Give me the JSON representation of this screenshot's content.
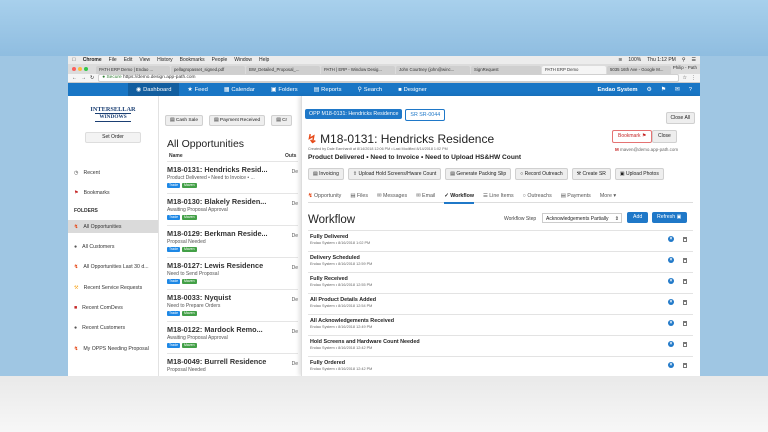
{
  "macos": {
    "menu": [
      "Chrome",
      "File",
      "Edit",
      "View",
      "History",
      "Bookmarks",
      "People",
      "Window",
      "Help"
    ],
    "battery": "100%",
    "clock": "Thu 1:12 PM"
  },
  "browser": {
    "tabs": [
      {
        "label": "PATH ERP Demo | Endao ...",
        "active": false
      },
      {
        "label": "pellagropasset_signed.pdf",
        "active": false
      },
      {
        "label": "BW_Detailed_Proposal_...",
        "active": false
      },
      {
        "label": "PATH | ERP - Window Desig...",
        "active": false
      },
      {
        "label": "John Courtney (john@winc...",
        "active": false
      },
      {
        "label": "SignRequest",
        "active": false
      },
      {
        "label": "PATH ERP Demo",
        "active": true
      },
      {
        "label": "5035 16th Ave - Google M...",
        "active": false
      }
    ],
    "user": "Philip - Path",
    "secure": "Secure",
    "url": "https://demo.design.app-path.com"
  },
  "nav": {
    "items": [
      "Dashboard",
      "Feed",
      "Calendar",
      "Folders",
      "Reports",
      "Search",
      "Designer"
    ],
    "system": "Endao System"
  },
  "sidebar": {
    "logo_line1": "INTERSELLAR",
    "logo_line2": "WINDOWS",
    "set_order": "Set Order",
    "recent": "Recent",
    "bookmarks": "Bookmarks",
    "folders_heading": "FOLDERS",
    "folders": [
      "All Opportunities",
      "All Customers",
      "All Opportunities Last 30 d...",
      "Recent Service Requests",
      "Recent ComDevs",
      "Recent Customers",
      "My OPPS Needing Proposal"
    ]
  },
  "opps": {
    "toolbar": [
      "Cash Sale",
      "Payment Received",
      "Cr"
    ],
    "title": "All Opportunities",
    "col_name": "Name",
    "col_right": "Outs",
    "rows": [
      {
        "title": "M18-0131: Hendricks Resid...",
        "sub": "Product Delivered • Need to Invoice • ...",
        "right": "De",
        "tags": [
          "Trade",
          "Maven"
        ]
      },
      {
        "title": "M18-0130: Blakely Residen...",
        "sub": "Awaiting Proposal Approval",
        "right": "De",
        "tags": [
          "Trade",
          "Maven"
        ]
      },
      {
        "title": "M18-0129: Berkman Reside...",
        "sub": "Proposal Needed",
        "right": "De",
        "tags": [
          "Trade",
          "Maven"
        ]
      },
      {
        "title": "M18-0127: Lewis Residence",
        "sub": "Need to Send Proposal",
        "right": "De",
        "tags": [
          "Trade",
          "Maven"
        ]
      },
      {
        "title": "M18-0033: Nyquist",
        "sub": "Need to Prepare Orders",
        "right": "De",
        "tags": [
          "Trade",
          "Maven"
        ]
      },
      {
        "title": "M18-0122: Mardock Remo...",
        "sub": "Awaiting Proposal Approval",
        "right": "De",
        "tags": [
          "Trade",
          "Maven"
        ]
      },
      {
        "title": "M18-0049: Burrell Residence",
        "sub": "Proposal Needed",
        "right": "De",
        "tags": []
      }
    ]
  },
  "detail": {
    "tab_primary": "OPP M18-0131: Hendricks Residence",
    "tab_secondary": "SR SR-0044",
    "close_all": "Close All",
    "title": "M18-0131: Hendricks Residence",
    "meta": "Created by Dale Earnhardt at 8/14/2018 12:06 PM • Last Modified 8/14/2018 1:02 PM",
    "status": "Product Delivered • Need to Invoice • Need to Upload HS&HW Count",
    "bookmark": "Bookmark",
    "close": "Close",
    "email": "maven@demo.app-path.com",
    "actions": [
      "Invoicing",
      "Upload Hold Screens/Hware Count",
      "Generate Packing Slip",
      "Record Outreach",
      "Create SR",
      "Upload Photos"
    ],
    "subtabs": [
      "Opportunity",
      "Files",
      "Messages",
      "Email",
      "Workflow",
      "Line Items",
      "Outreachs",
      "Payments",
      "More"
    ],
    "active_subtab": "Workflow"
  },
  "workflow": {
    "title": "Workflow",
    "step_label": "Workflow Step",
    "step_value": "Acknowledgements Partially",
    "add": "Add",
    "refresh": "Refresh",
    "rows": [
      {
        "name": "Fully Delivered",
        "by": "Endao System • 8/16/2018 1:02 PM"
      },
      {
        "name": "Delivery Scheduled",
        "by": "Endao System • 8/16/2018 12:59 PM"
      },
      {
        "name": "Fully Received",
        "by": "Endao System • 8/16/2018 12:55 PM"
      },
      {
        "name": "All Product Details Added",
        "by": "Endao System • 8/16/2018 12:54 PM"
      },
      {
        "name": "All Acknowledgements Received",
        "by": "Endao System • 8/16/2018 12:49 PM"
      },
      {
        "name": "Hold Screens and Hardware Count Needed",
        "by": "Endao System • 8/16/2018 12:42 PM"
      },
      {
        "name": "Fully Ordered",
        "by": "Endao System • 8/16/2018 12:42 PM"
      }
    ]
  },
  "colors": {
    "primary": "#1976c5",
    "trade": "#1e88e5",
    "maven": "#43a047",
    "alert": "#e64a19"
  }
}
